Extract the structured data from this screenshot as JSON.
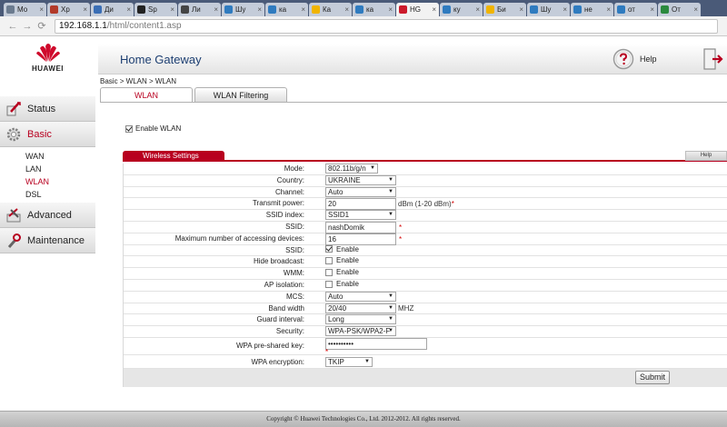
{
  "browser": {
    "tabs": [
      {
        "label": "Мо",
        "icon_color": "#6b7b8f",
        "active": false
      },
      {
        "label": "Хр",
        "icon_color": "#b23a2a",
        "active": false
      },
      {
        "label": "Ди",
        "icon_color": "#3a6eb5",
        "active": false
      },
      {
        "label": "Sp",
        "icon_color": "#222222",
        "active": false
      },
      {
        "label": "Ли",
        "icon_color": "#444444",
        "active": false
      },
      {
        "label": "Шу",
        "icon_color": "#2f7bbf",
        "active": false
      },
      {
        "label": "ка",
        "icon_color": "#2f7bbf",
        "active": false
      },
      {
        "label": "Ка",
        "icon_color": "#f0b400",
        "active": false
      },
      {
        "label": "ка",
        "icon_color": "#2f7bbf",
        "active": false
      },
      {
        "label": "HG",
        "icon_color": "#cc1a2b",
        "active": true
      },
      {
        "label": "ку",
        "icon_color": "#2f7bbf",
        "active": false
      },
      {
        "label": "Би",
        "icon_color": "#f0b400",
        "active": false
      },
      {
        "label": "Шу",
        "icon_color": "#2f7bbf",
        "active": false
      },
      {
        "label": "не",
        "icon_color": "#2f7bbf",
        "active": false
      },
      {
        "label": "от",
        "icon_color": "#2f7bbf",
        "active": false
      },
      {
        "label": "От",
        "icon_color": "#2b8a3e",
        "active": false
      }
    ],
    "url_host": "192.168.1.1",
    "url_path": "/html/content1.asp"
  },
  "header": {
    "brand": "HUAWEI",
    "title": "Home Gateway",
    "help_label": "Help"
  },
  "sidebar": {
    "items": [
      {
        "label": "Status",
        "selected": false
      },
      {
        "label": "Basic",
        "selected": true
      },
      {
        "label": "Advanced",
        "selected": false
      },
      {
        "label": "Maintenance",
        "selected": false
      }
    ],
    "basic_submenu": [
      {
        "label": "WAN",
        "active": false
      },
      {
        "label": "LAN",
        "active": false
      },
      {
        "label": "WLAN",
        "active": true
      },
      {
        "label": "DSL",
        "active": false
      }
    ]
  },
  "breadcrumb": "Basic > WLAN > WLAN",
  "tabs": [
    {
      "label": "WLAN",
      "active": true
    },
    {
      "label": "WLAN Filtering",
      "active": false
    }
  ],
  "enable_wlan": {
    "label": "Enable WLAN",
    "checked": true
  },
  "section": {
    "title": "Wireless Settings",
    "help": "Help"
  },
  "settings": {
    "mode": {
      "label": "Mode:",
      "value": "802.11b/g/n"
    },
    "country": {
      "label": "Country:",
      "value": "UKRAINE"
    },
    "channel": {
      "label": "Channel:",
      "value": "Auto"
    },
    "transmit_power": {
      "label": "Transmit power:",
      "value": "20",
      "hint": "dBm (1-20 dBm)",
      "required": "*"
    },
    "ssid_index": {
      "label": "SSID index:",
      "value": "SSID1"
    },
    "ssid": {
      "label": "SSID:",
      "value": "nashDomik",
      "required": "*"
    },
    "max_devices": {
      "label": "Maximum number of accessing devices:",
      "value": "16",
      "required": "*"
    },
    "ssid_enable": {
      "label": "SSID:",
      "option": "Enable",
      "checked": true
    },
    "hide_broadcast": {
      "label": "Hide broadcast:",
      "option": "Enable",
      "checked": false
    },
    "wmm": {
      "label": "WMM:",
      "option": "Enable",
      "checked": false
    },
    "ap_isolation": {
      "label": "AP isolation:",
      "option": "Enable",
      "checked": false
    },
    "mcs": {
      "label": "MCS:",
      "value": "Auto"
    },
    "band_width": {
      "label": "Band width",
      "value": "20/40",
      "unit": "MHZ"
    },
    "guard_interval": {
      "label": "Guard interval:",
      "value": "Long"
    },
    "security": {
      "label": "Security:",
      "value": "WPA-PSK/WPA2-F"
    },
    "wpa_key": {
      "label": "WPA pre-shared key:",
      "value": "••••••••••",
      "required": "*"
    },
    "wpa_encryption": {
      "label": "WPA encryption:",
      "value": "TKIP"
    }
  },
  "submit_label": "Submit",
  "footer": "Copyright © Huawei Technologies Co., Ltd. 2012-2012. All rights reserved."
}
